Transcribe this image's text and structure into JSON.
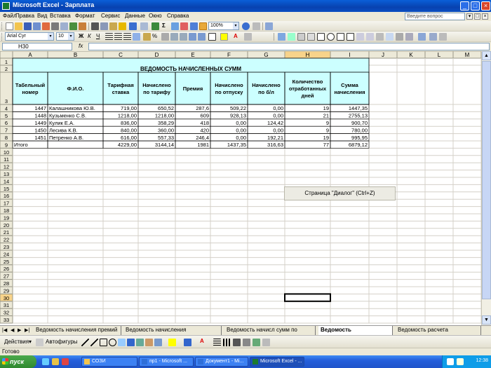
{
  "window": {
    "title": "Microsoft Excel - Зарплата"
  },
  "menu": {
    "items": [
      "Файл",
      "Правка",
      "Вид",
      "Вставка",
      "Формат",
      "Сервис",
      "Данные",
      "Окно",
      "Справка"
    ],
    "help_placeholder": "Введите вопрос"
  },
  "toolbar": {
    "zoom": "100%",
    "font_name": "Arial Cyr",
    "font_size": "10"
  },
  "formula_bar": {
    "name_box": "H30",
    "fx": "fx",
    "value": ""
  },
  "sheet": {
    "columns": [
      "A",
      "B",
      "C",
      "D",
      "E",
      "F",
      "G",
      "H",
      "I",
      "J",
      "K",
      "L",
      "M"
    ],
    "row_count": 33,
    "title": "ВЕДОМОСТЬ НАЧИСЛЕННЫХ СУММ",
    "headers": [
      [
        "Табельный",
        "номер"
      ],
      [
        "Ф.И.О."
      ],
      [
        "Тарифная",
        "ставка"
      ],
      [
        "Начислено",
        "по тарифу"
      ],
      [
        "Премия"
      ],
      [
        "Начислено",
        "по отпуску"
      ],
      [
        "Начислено",
        "по б/л"
      ],
      [
        "Количество",
        "отработанных",
        "дней"
      ],
      [
        "Сумма",
        "начисления"
      ]
    ],
    "rows": [
      [
        "1447",
        "Калашникова Ю.В.",
        "719,00",
        "650,52",
        "287,6",
        "509,22",
        "0,00",
        "19",
        "1447,35"
      ],
      [
        "1448",
        "Кузьменко С.В.",
        "1218,00",
        "1218,00",
        "609",
        "928,13",
        "0,00",
        "21",
        "2755,13"
      ],
      [
        "1449",
        "Кулик Е.А.",
        "836,00",
        "358,29",
        "418",
        "0,00",
        "124,42",
        "9",
        "900,70"
      ],
      [
        "1450",
        "Лесива К.В.",
        "840,00",
        "360,00",
        "420",
        "0,00",
        "0,00",
        "9",
        "780,00"
      ],
      [
        "1451",
        "Петренко А.В.",
        "616,00",
        "557,33",
        "246,4",
        "0,00",
        "192,21",
        "19",
        "995,95"
      ]
    ],
    "total": [
      "Итого",
      "",
      "4229,00",
      "3144,14",
      "1981",
      "1437,35",
      "316,63",
      "77",
      "6879,12"
    ]
  },
  "dialog_button": {
    "label": "Страница \"Диалог\" (Ctrl+Z)"
  },
  "tabs": [
    "Ведомость начисления премий",
    "Ведомость начисления больничных",
    "Ведомость начисл сумм по отпуск",
    "Ведомость начисл_сумм",
    "Ведомость расчета пенс_налога"
  ],
  "active_tab": 3,
  "drawing": {
    "actions": "Действия",
    "autoshapes": "Автофигуры"
  },
  "status": {
    "text": "Готово"
  },
  "taskbar": {
    "start": "пуск",
    "tasks": [
      "СОЗИ",
      "пр1 - Microsoft ...",
      "Документ1 - Mi...",
      "Microsoft Excel - ..."
    ],
    "active_task": 3,
    "clock": "12:38"
  },
  "colors": {
    "header_fill": "#ccffff",
    "selected_header": "#f8d38a",
    "grid_line": "#d4d0c8"
  }
}
